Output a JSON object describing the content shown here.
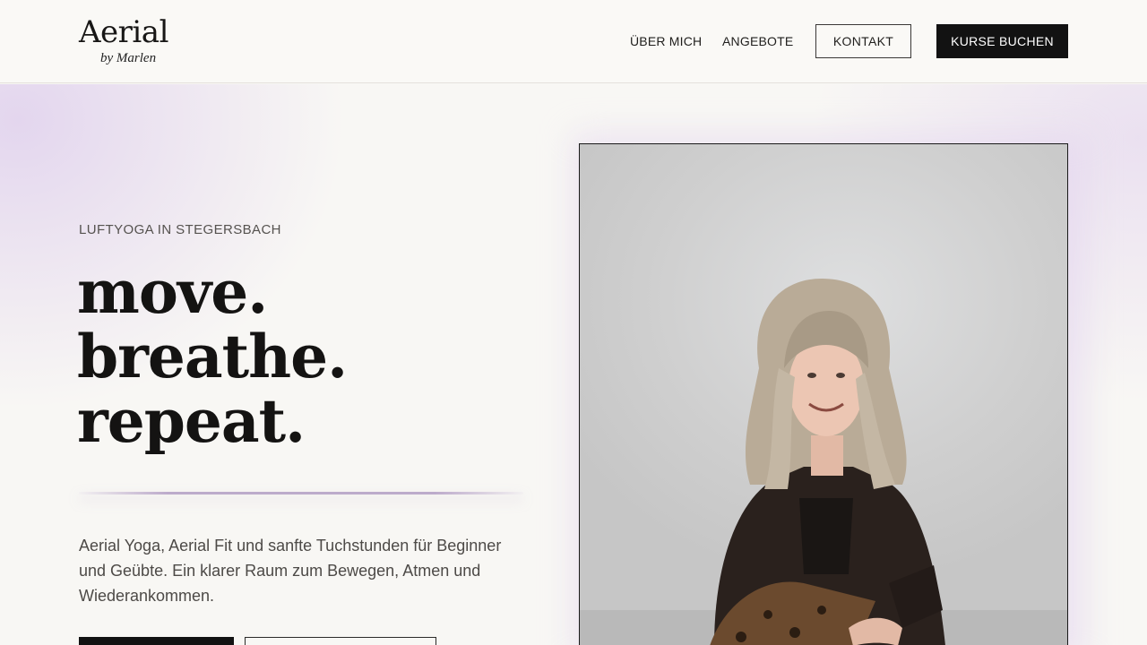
{
  "brand": {
    "name": "Aerial",
    "tagline": "by Marlen"
  },
  "nav": {
    "items": [
      {
        "label": "ÜBER MICH"
      },
      {
        "label": "ANGEBOTE"
      }
    ],
    "contact_label": "KONTAKT",
    "book_label": "KURSE BUCHEN"
  },
  "hero": {
    "eyebrow": "LUFTYOGA IN STEGERSBACH",
    "headline": [
      "move.",
      "breathe.",
      "repeat."
    ],
    "lead": "Aerial Yoga, Aerial Fit und sanfte Tuchstunden für Beginner und Geübte. Ein klarer Raum zum Bewegen, Atmen und Wiederankommen.",
    "photo": "portrait-photo"
  },
  "colors": {
    "accent": "#bcaacb",
    "dark": "#121212",
    "background": "#f8f7f4"
  }
}
